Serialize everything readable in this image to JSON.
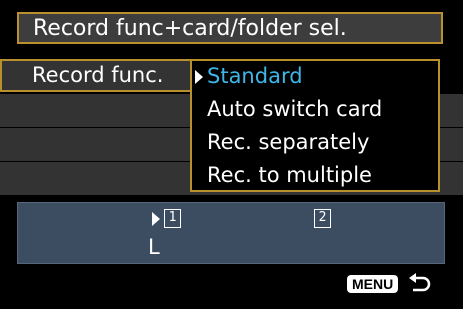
{
  "title": "Record func+card/folder sel.",
  "setting": {
    "label": "Record func.",
    "options": [
      "Standard",
      "Auto switch card",
      "Rec. separately",
      "Rec. to multiple"
    ],
    "selected_option": "Standard"
  },
  "cards": {
    "card1": "1",
    "card2": "2",
    "quality": "L"
  },
  "footer": {
    "menu_label": "MENU",
    "return_icon": "return-arrow-icon"
  },
  "colors": {
    "highlight_border": "#b8902c",
    "selected_option_text": "#3fb6e8",
    "info_panel": "#3c4d61",
    "row_background": "#333333"
  }
}
